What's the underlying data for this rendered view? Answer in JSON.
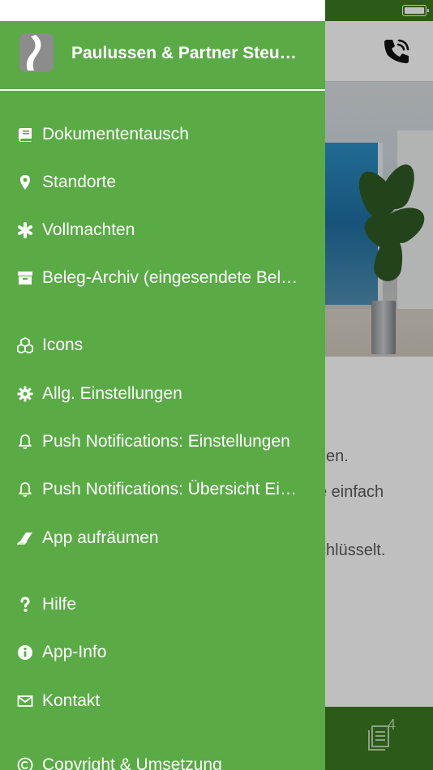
{
  "drawer": {
    "title": "Paulussen & Partner Steu…",
    "items": [
      {
        "label": "Dokumententausch",
        "icon": "book-icon"
      },
      {
        "label": "Standorte",
        "icon": "map-pin-icon"
      },
      {
        "label": "Vollmachten",
        "icon": "asterisk-icon"
      },
      {
        "label": "Beleg-Archiv (eingesendete Bel…",
        "icon": "archive-box-icon"
      },
      {
        "label": "Icons",
        "icon": "cubes-icon"
      },
      {
        "label": "Allg. Einstellungen",
        "icon": "gear-icon"
      },
      {
        "label": "Push Notifications: Einstellungen",
        "icon": "bell-icon"
      },
      {
        "label": "Push Notifications: Übersicht Ei…",
        "icon": "bell-icon"
      },
      {
        "label": "App aufräumen",
        "icon": "eraser-icon"
      },
      {
        "label": "Hilfe",
        "icon": "question-icon"
      },
      {
        "label": "App-Info",
        "icon": "info-circle-icon"
      },
      {
        "label": "Kontakt",
        "icon": "envelope-icon"
      },
      {
        "label": "Copyright & Umsetzung",
        "icon": "copyright-icon"
      }
    ]
  },
  "background": {
    "lines": [
      "zen.",
      "e einfach",
      "chlüsselt."
    ],
    "tab_badge": "4"
  },
  "colors": {
    "drawer_green": "#5aab46",
    "dark_green": "#3b7a22"
  }
}
